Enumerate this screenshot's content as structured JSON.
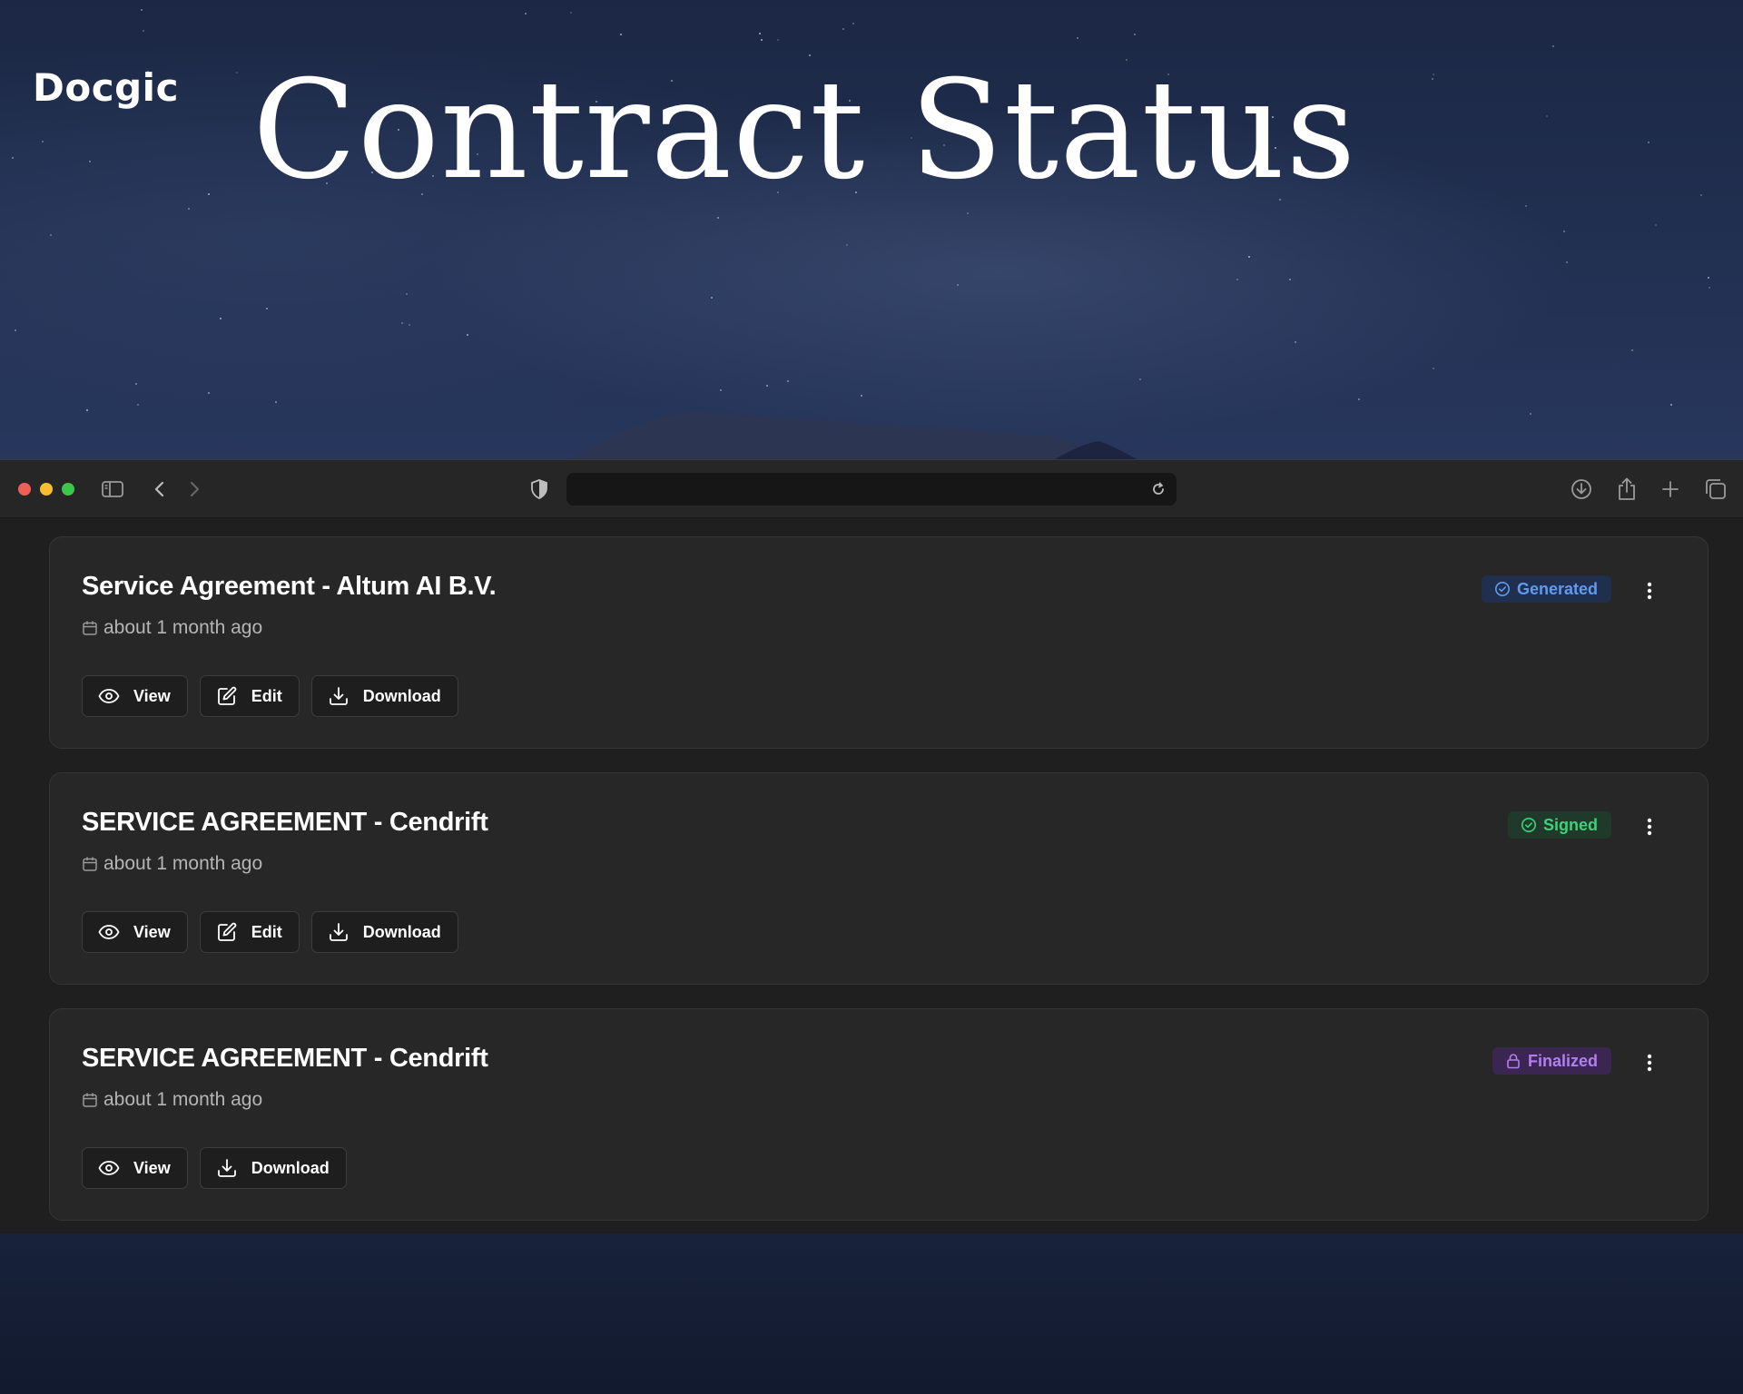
{
  "brand": {
    "logo_text": "Docgic"
  },
  "hero": {
    "title": "Contract Status"
  },
  "browser": {
    "url": ""
  },
  "contracts": [
    {
      "title": "Service Agreement - Altum AI B.V.",
      "date": "about 1 month ago",
      "status": "Generated",
      "status_icon": "check-circle-icon",
      "status_color": "#5f9bf0",
      "actions": [
        "View",
        "Edit",
        "Download"
      ]
    },
    {
      "title": "SERVICE AGREEMENT - Cendrift",
      "date": "about 1 month ago",
      "status": "Signed",
      "status_icon": "check-circle-icon",
      "status_color": "#3fd27a",
      "actions": [
        "View",
        "Edit",
        "Download"
      ]
    },
    {
      "title": "SERVICE AGREEMENT - Cendrift",
      "date": "about 1 month ago",
      "status": "Finalized",
      "status_icon": "lock-icon",
      "status_color": "#b27ff0",
      "actions": [
        "View",
        "Download"
      ]
    }
  ]
}
